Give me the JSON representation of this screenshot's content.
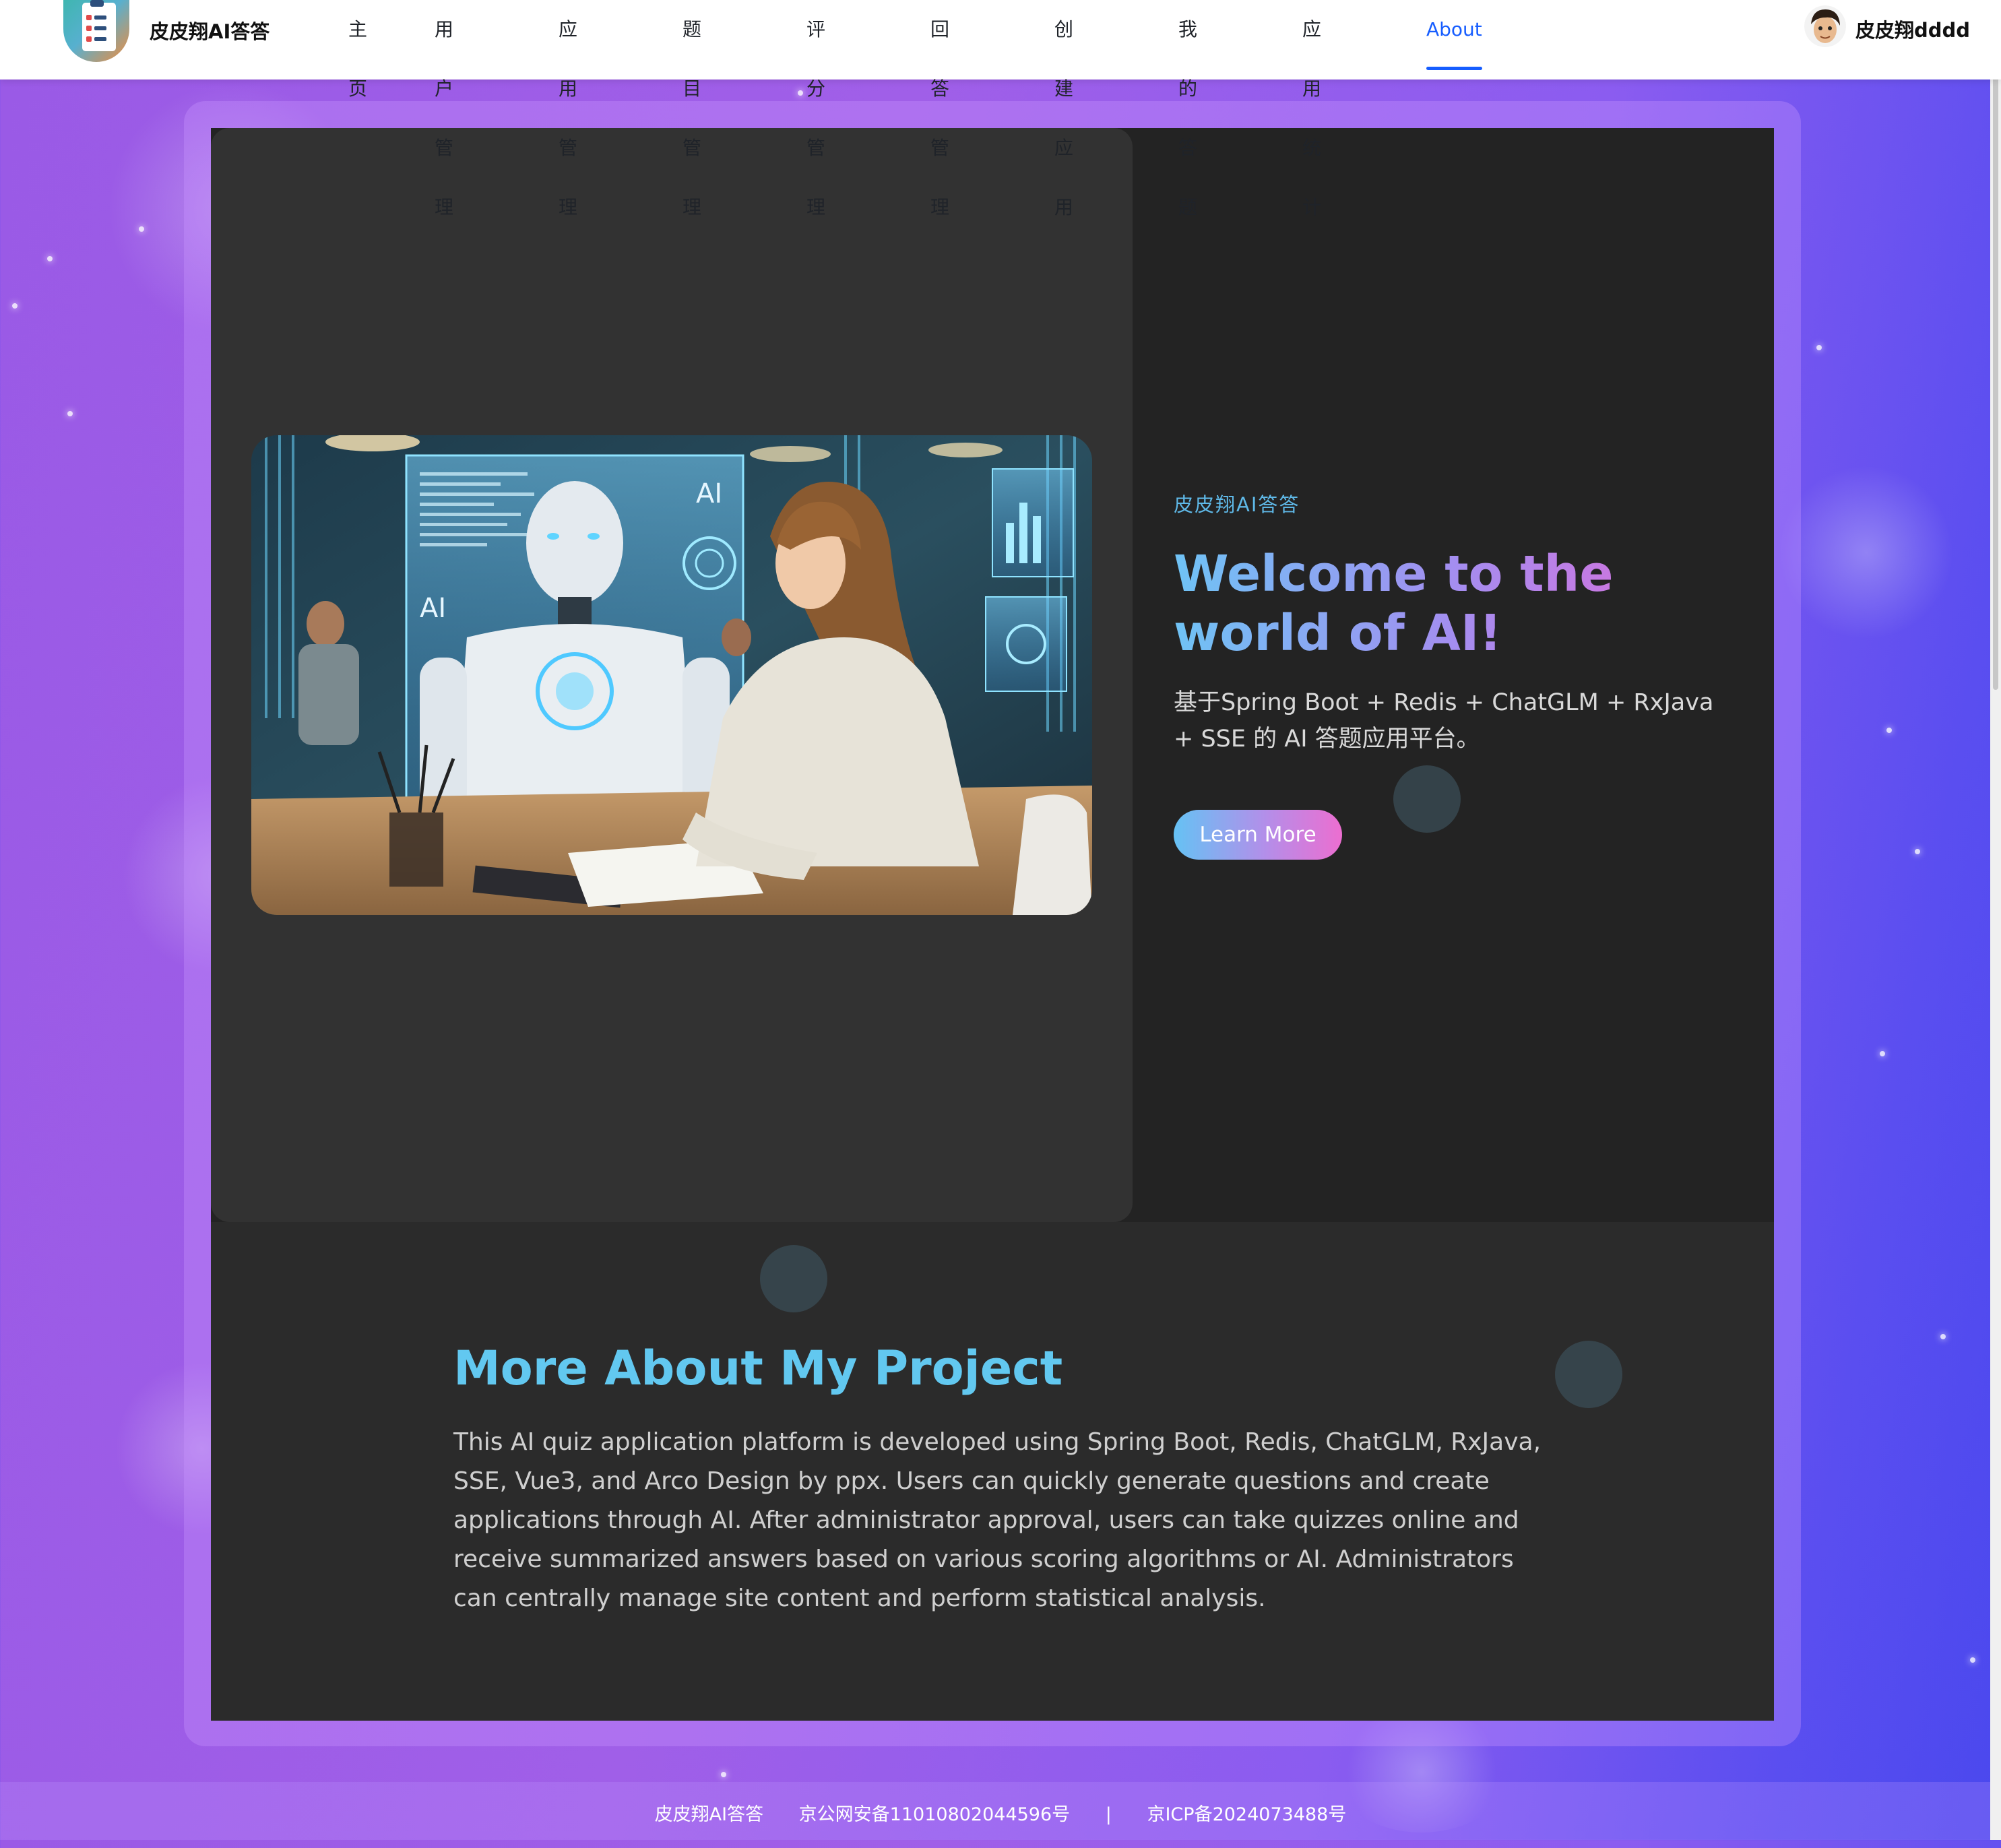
{
  "header": {
    "site_name": "皮皮翔AI答答",
    "nav": [
      {
        "label": "主页"
      },
      {
        "label": "用户管理"
      },
      {
        "label": "应用管理"
      },
      {
        "label": "题目管理"
      },
      {
        "label": "评分管理"
      },
      {
        "label": "回答管理"
      },
      {
        "label": "创建应用"
      },
      {
        "label": "我的答题"
      },
      {
        "label": "应用统计"
      },
      {
        "label": "About",
        "active": true
      }
    ],
    "user_name": "皮皮翔dddd"
  },
  "hero": {
    "tag": "皮皮翔AI答答",
    "title": "Welcome to the world of AI!",
    "subtitle": "基于Spring Boot + Redis + ChatGLM + RxJava + SSE 的 AI 答题应用平台。",
    "button_label": "Learn More",
    "image_labels": [
      "AI",
      "AI"
    ]
  },
  "project": {
    "title": "More About My Project",
    "text": "This AI quiz application platform is developed using Spring Boot, Redis, ChatGLM, RxJava, SSE, Vue3, and Arco Design by ppx. Users can quickly generate questions and create applications through AI. After administrator approval, users can take quizzes online and receive summarized answers based on various scoring algorithms or AI. Administrators can centrally manage site content and perform statistical analysis."
  },
  "footer": {
    "site_name": "皮皮翔AI答答",
    "police_record": "京公网安备11010802044596号",
    "separator": "|",
    "icp_record": "京ICP备2024073488号"
  },
  "colors": {
    "active_nav": "#165dff",
    "accent_cyan": "#62c8f0",
    "accent_pink": "#e06ad8"
  }
}
